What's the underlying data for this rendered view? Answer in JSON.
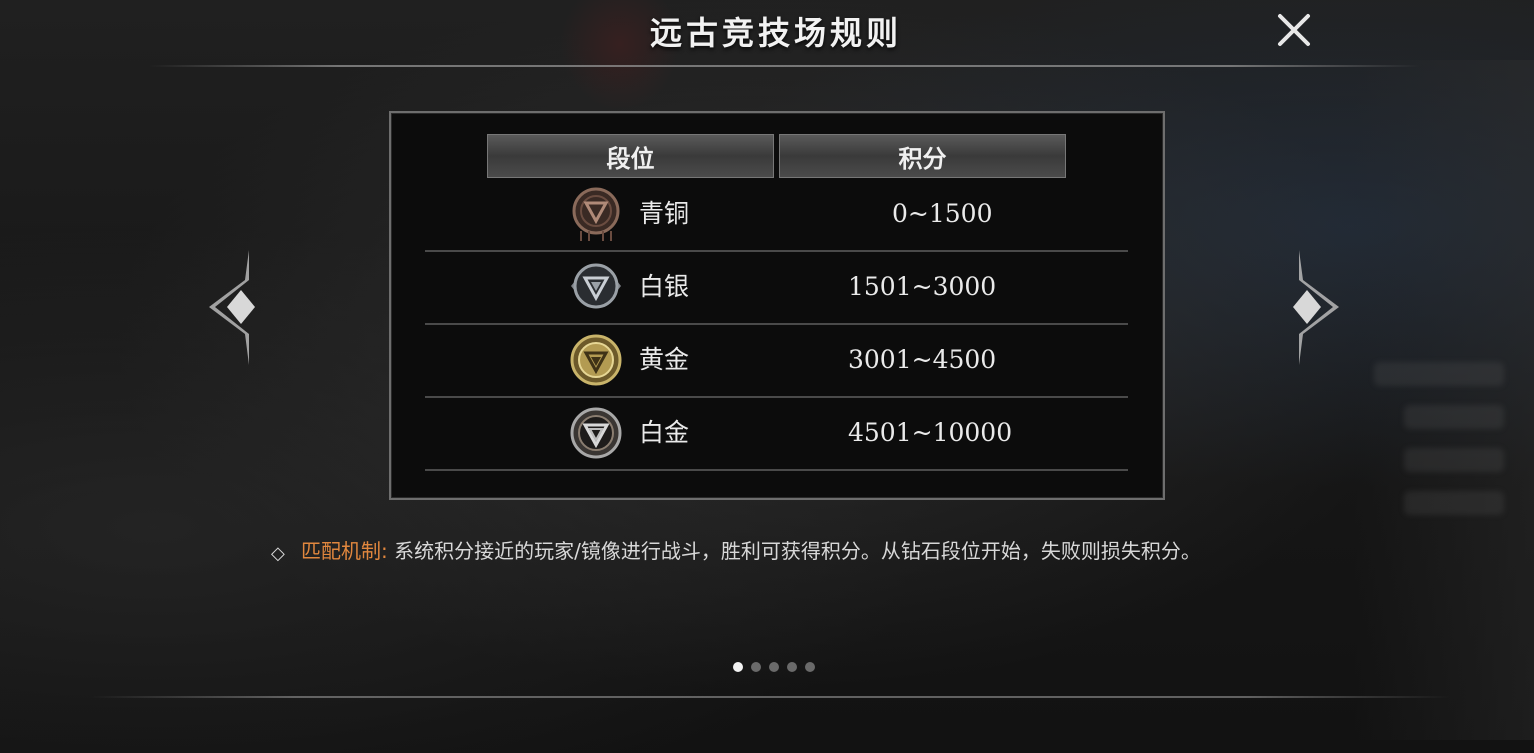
{
  "window": {
    "title": "远古竞技场规则"
  },
  "table": {
    "headers": {
      "rank": "段位",
      "score": "积分"
    },
    "rows": [
      {
        "rank": "青铜",
        "score": "0~1500",
        "badge": "bronze-badge-icon",
        "color": "#8a6a5a"
      },
      {
        "rank": "白银",
        "score": "1501~3000",
        "badge": "silver-badge-icon",
        "color": "#9aa0a6"
      },
      {
        "rank": "黄金",
        "score": "3001~4500",
        "badge": "gold-badge-icon",
        "color": "#c9b46a"
      },
      {
        "rank": "白金",
        "score": "4501~10000",
        "badge": "platinum-badge-icon",
        "color": "#a8a8a8"
      }
    ]
  },
  "rule": {
    "label": "匹配机制:",
    "text": "系统积分接近的玩家/镜像进行战斗，胜利可获得积分。从钻石段位开始，失败则损失积分。"
  },
  "pagination": {
    "total": 5,
    "current": 1
  },
  "colors": {
    "accent": "#e1873e",
    "text": "#eaeaea",
    "frame": "#6e6e6e"
  }
}
